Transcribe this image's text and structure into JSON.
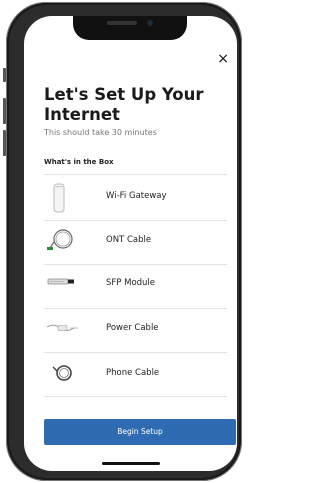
{
  "header": {
    "close_icon": "×",
    "title": "Let's Set Up Your Internet",
    "subtitle": "This should take 30 minutes"
  },
  "section": {
    "title": "What's in the Box"
  },
  "items": [
    {
      "label": "Wi-Fi Gateway",
      "icon": "wifi-gateway-icon"
    },
    {
      "label": "ONT Cable",
      "icon": "ont-cable-icon"
    },
    {
      "label": "SFP Module",
      "icon": "sfp-module-icon"
    },
    {
      "label": "Power Cable",
      "icon": "power-cable-icon"
    },
    {
      "label": "Phone Cable",
      "icon": "phone-cable-icon"
    }
  ],
  "actions": {
    "begin_label": "Begin Setup"
  },
  "colors": {
    "primary": "#2f6bb3",
    "ont_accent": "#2e8b3d"
  }
}
